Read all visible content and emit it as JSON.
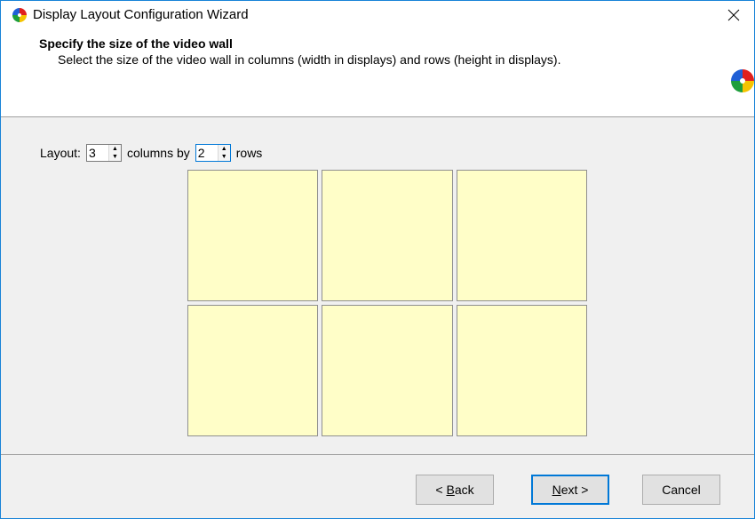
{
  "window": {
    "title": "Display Layout Configuration Wizard",
    "app_icon": "color-wheel-icon",
    "close_icon": "close-icon"
  },
  "header": {
    "title": "Specify the size of the video wall",
    "subtitle": "Select the size of the video wall in columns (width in displays) and rows (height in displays).",
    "icon": "color-wheel-icon"
  },
  "layout": {
    "label": "Layout:",
    "columns_value": "3",
    "columns_by_label": "columns by",
    "rows_value": "2",
    "rows_label": "rows",
    "cell_color": "#fffec8"
  },
  "buttons": {
    "back_accel": "B",
    "back_rest": "ack",
    "back_prefix": "< ",
    "next_accel": "N",
    "next_rest": "ext >",
    "cancel": "Cancel"
  }
}
